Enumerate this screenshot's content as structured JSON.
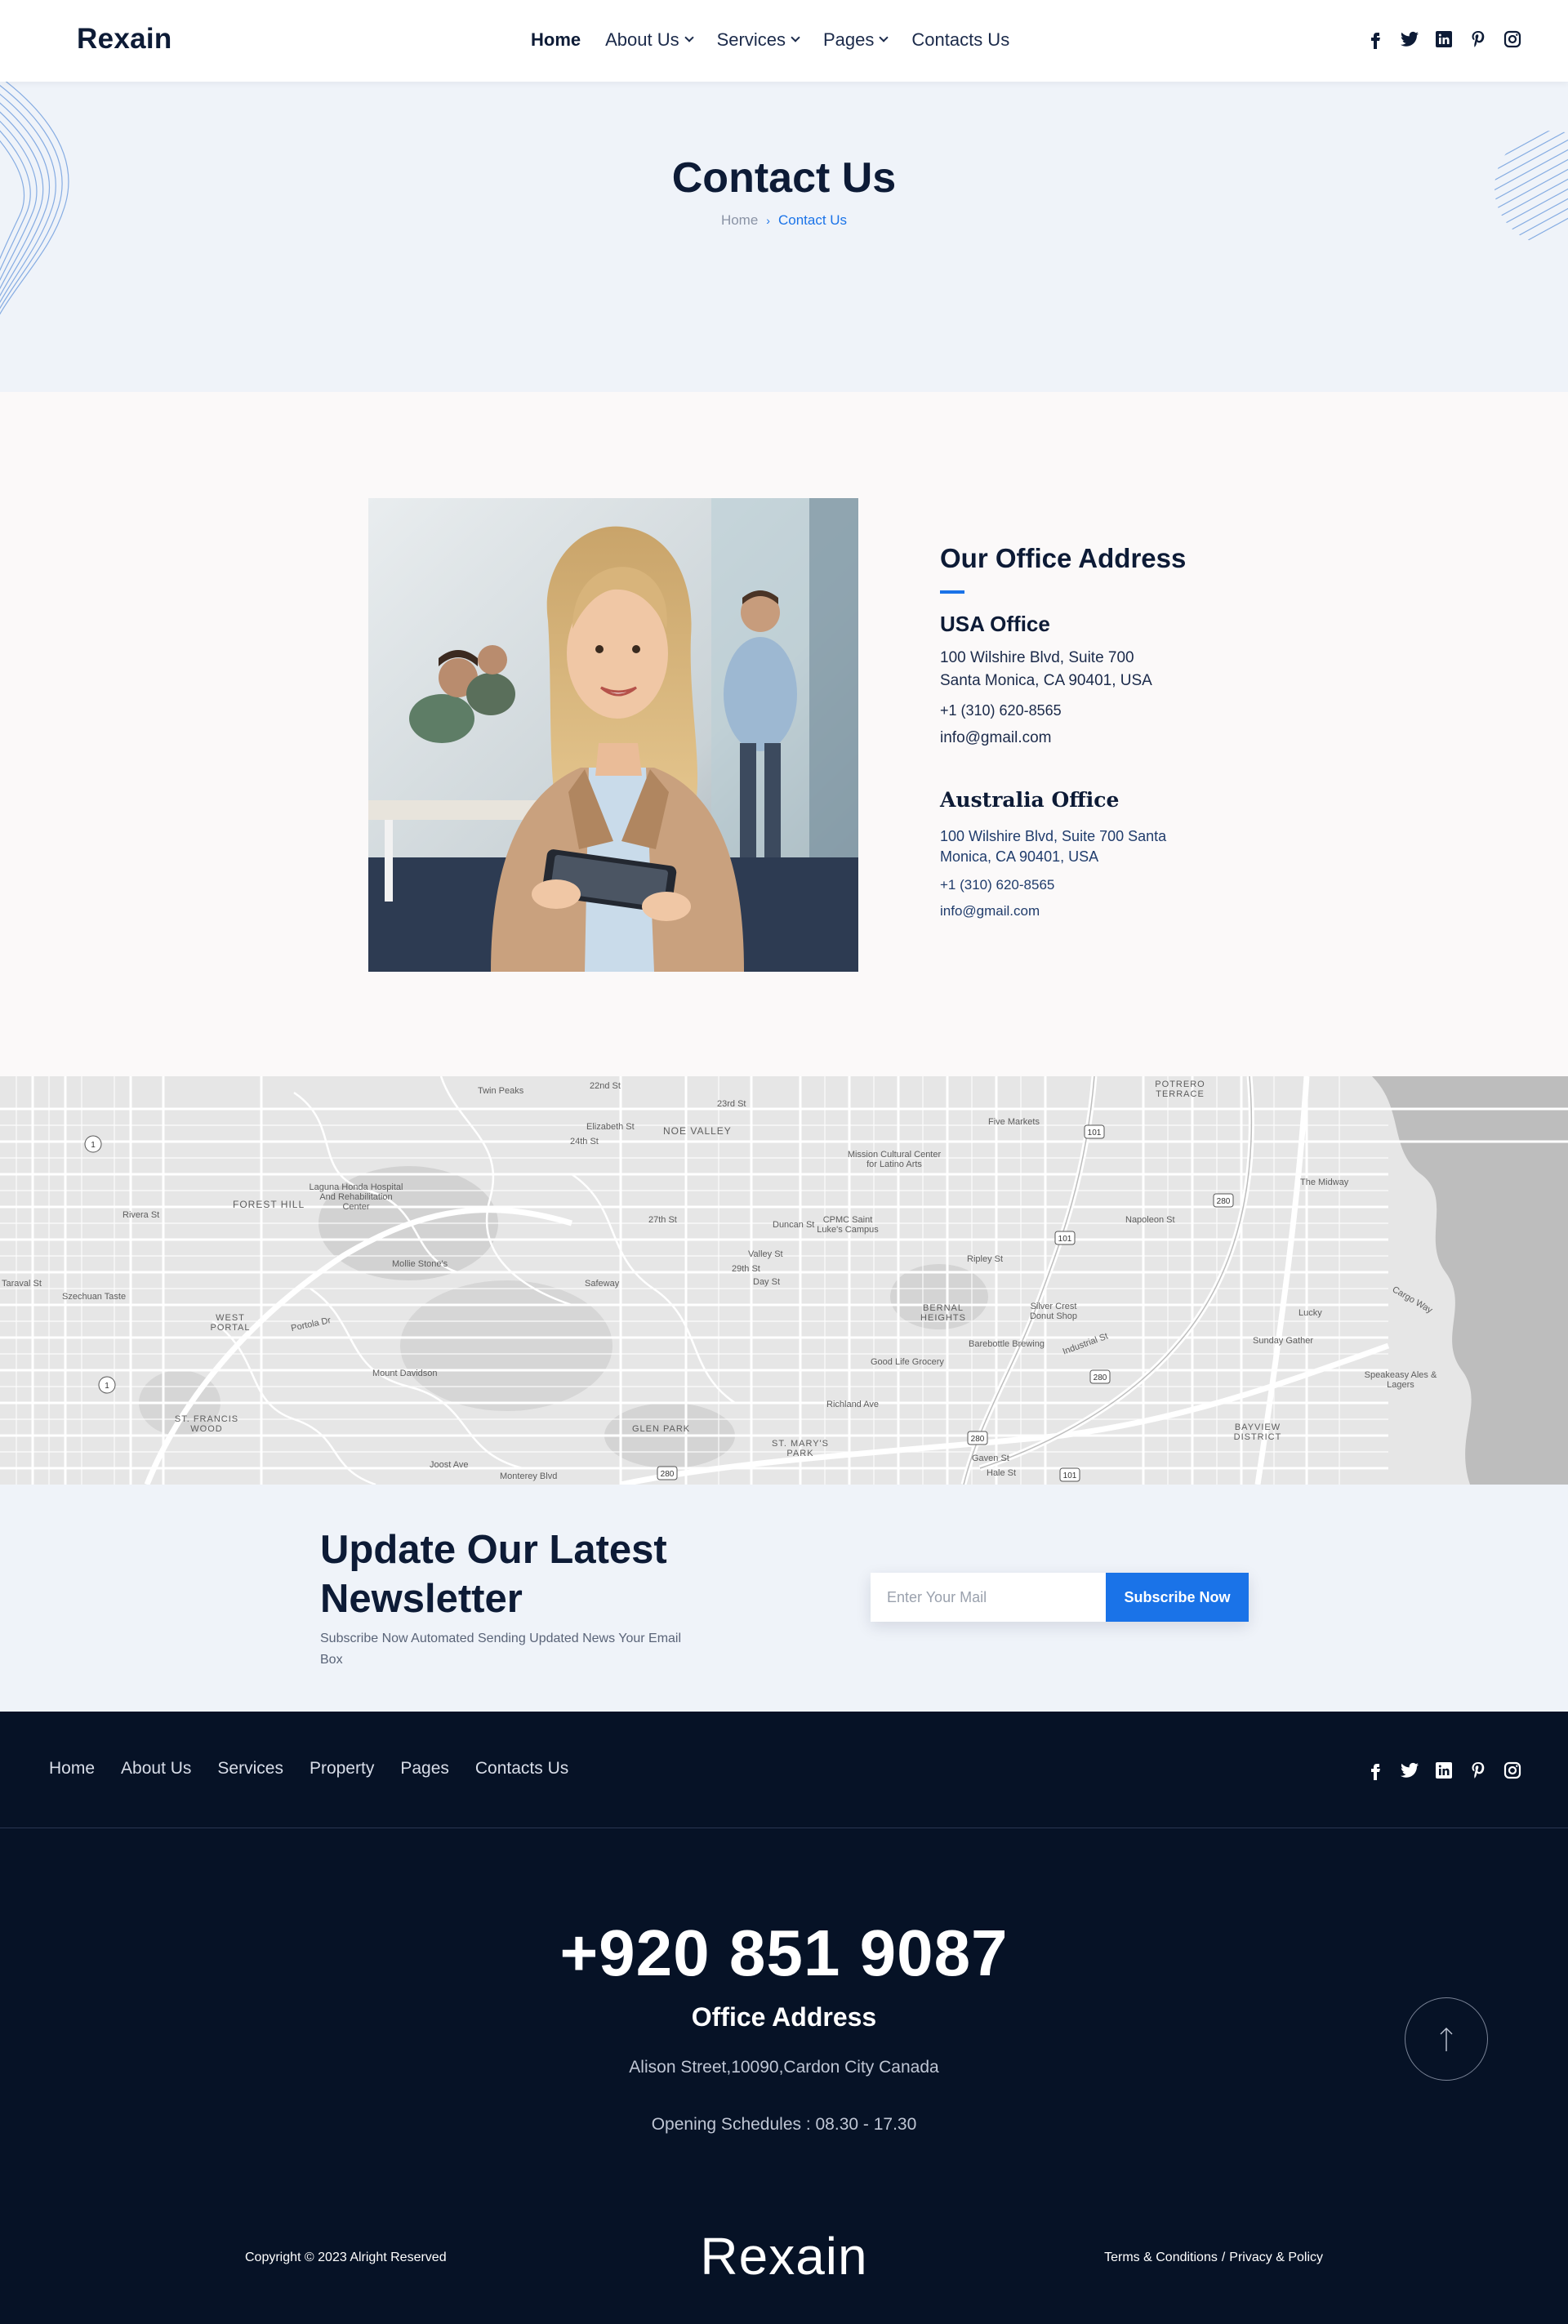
{
  "header": {
    "logo": "Rexain",
    "nav": [
      {
        "label": "Home"
      },
      {
        "label": "About Us"
      },
      {
        "label": "Services"
      },
      {
        "label": "Pages"
      },
      {
        "label": "Contacts Us"
      }
    ],
    "social_icons": [
      "facebook-icon",
      "twitter-icon",
      "linkedin-icon",
      "pinterest-icon",
      "instagram-icon"
    ]
  },
  "hero": {
    "title": "Contact Us",
    "breadcrumb_home": "Home",
    "breadcrumb_sep": "›",
    "breadcrumb_current": "Contact Us"
  },
  "office": {
    "heading": "Our Office Address",
    "usa": {
      "title": "USA Office",
      "address_line1": "100 Wilshire Blvd, Suite 700",
      "address_line2": "Santa Monica, CA 90401, USA",
      "phone": "+1 (310) 620-8565",
      "email": "info@gmail.com"
    },
    "australia": {
      "title": "Australia Office",
      "address": "100 Wilshire Blvd, Suite 700 Santa Monica, CA 90401, USA",
      "phone": "+1 (310) 620-8565",
      "email": "info@gmail.com"
    }
  },
  "map": {
    "labels": [
      "Twin Peaks",
      "22nd St",
      "23rd St",
      "24th St",
      "NOE VALLEY",
      "Elizabeth St",
      "Mission Cultural Center for Latino Arts",
      "Five Markets",
      "POTRERO TERRACE",
      "The Midway",
      "FOREST HILL",
      "Laguna Honda Hospital And Rehabilitation Center",
      "Mollie Stone's",
      "Safeway",
      "CPMC Saint Luke's Campus",
      "Ripley St",
      "Napoleon St",
      "Cargo Way",
      "Lucky",
      "Sunday Gather",
      "Speakeasy Ales & Lagers",
      "BERNAL HEIGHTS",
      "Good Life Grocery",
      "Barebottle Brewing",
      "Silver Crest Donut Shop",
      "WEST PORTAL",
      "Portola Dr",
      "Mount Davidson",
      "GLEN PARK",
      "ST. MARY'S PARK",
      "ST. FRANCIS WOOD",
      "Monterey Blvd",
      "BAYVIEW DISTRICT",
      "Richland Ave",
      "Industrial St",
      "Taraval St",
      "Szechuan Taste",
      "Rivera St",
      "Valley St",
      "Day St",
      "29th St",
      "27th St",
      "Duncan St",
      "Joost Ave",
      "Gaven St",
      "Hale St"
    ]
  },
  "newsletter": {
    "title": "Update Our Latest Newsletter",
    "subtitle": "Subscribe Now Automated Sending Updated News Your Email Box",
    "placeholder": "Enter Your Mail",
    "button": "Subscribe Now"
  },
  "footer": {
    "nav": [
      {
        "label": "Home"
      },
      {
        "label": "About Us"
      },
      {
        "label": "Services"
      },
      {
        "label": "Property"
      },
      {
        "label": "Pages"
      },
      {
        "label": "Contacts Us"
      }
    ],
    "phone": "+920 851 9087",
    "office_title": "Office Address",
    "address": "Alison Street,10090,Cardon City Canada",
    "hours": "Opening Schedules : 08.30 - 17.30",
    "copyright": "Copyright © 2023 Alright Reserved",
    "logo": "Rexain",
    "terms": "Terms & Conditions",
    "legal_sep": "/",
    "privacy": "Privacy & Policy",
    "scroll_top_icon": "arrow-up-icon"
  },
  "colors": {
    "navy": "#0d1b36",
    "accent": "#1a73e8",
    "footer_bg": "#061226",
    "hero_bg": "#eff3f9"
  }
}
